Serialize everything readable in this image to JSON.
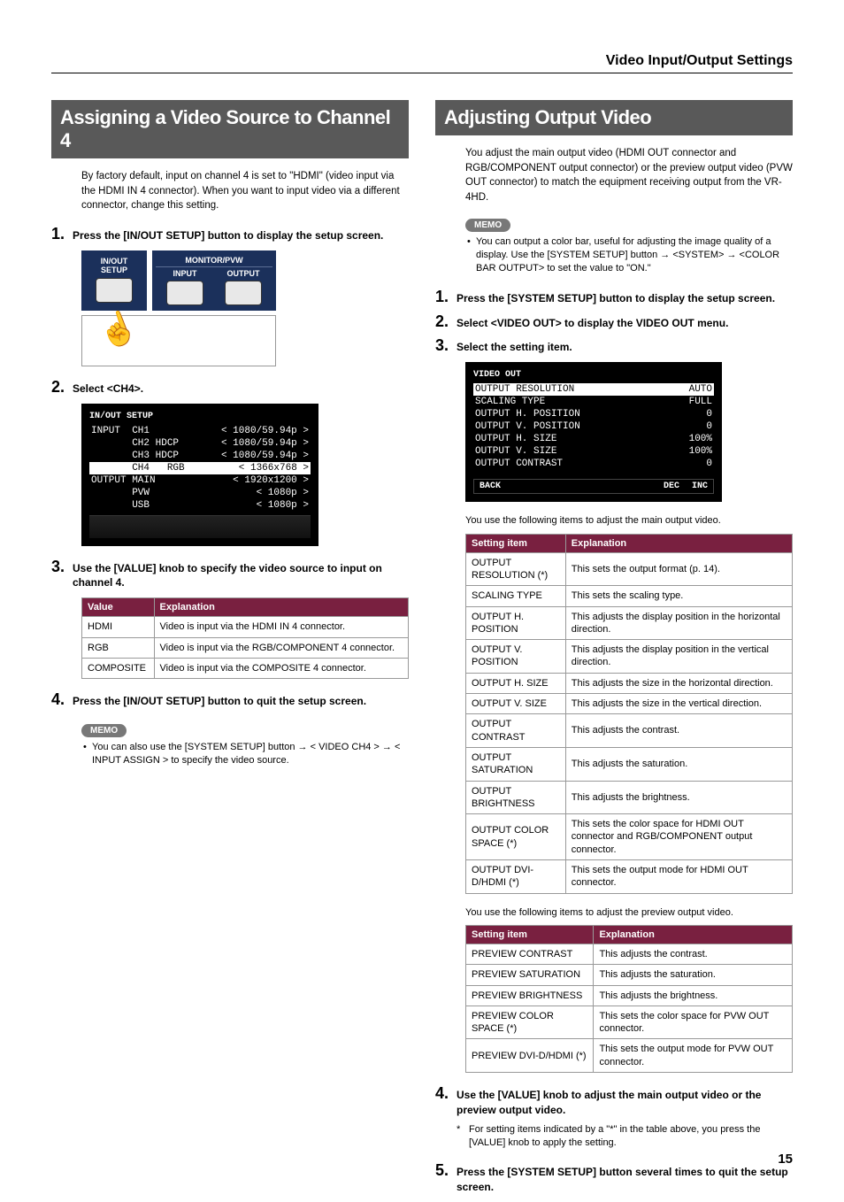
{
  "header": {
    "title": "Video Input/Output Settings"
  },
  "page_number": "15",
  "left": {
    "heading": "Assigning a Video Source to Channel 4",
    "intro": "By factory default, input on channel 4 is set to \"HDMI\" (video input via the HDMI IN 4 connector). When you want to input video via a different connector, change this setting.",
    "step1": "Press the [IN/OUT SETUP] button to display the setup screen.",
    "hw": {
      "inout": "IN/OUT\nSETUP",
      "monitorpvw": "MONITOR/PVW",
      "input": "INPUT",
      "output": "OUTPUT"
    },
    "step2": "Select <CH4>.",
    "lcd": {
      "title": "IN/OUT SETUP",
      "rows": [
        {
          "l": "INPUT  CH1",
          "r": "<  1080/59.94p >"
        },
        {
          "l": "       CH2 HDCP",
          "r": "<  1080/59.94p >"
        },
        {
          "l": "       CH3 HDCP",
          "r": "<  1080/59.94p >"
        },
        {
          "l": "       CH4",
          "mid": "RGB",
          "r": "<    1366x768 >",
          "sel": true
        },
        {
          "l": "OUTPUT MAIN",
          "r": "< 1920x1200 >"
        },
        {
          "l": "       PVW",
          "r": "< 1080p >"
        },
        {
          "l": "       USB",
          "r": "< 1080p >"
        }
      ]
    },
    "step3": "Use the [VALUE] knob to specify the video source to input on channel 4.",
    "table": {
      "headers": [
        "Value",
        "Explanation"
      ],
      "rows": [
        [
          "HDMI",
          "Video is input via the HDMI IN 4 connector."
        ],
        [
          "RGB",
          "Video is input via the RGB/COMPONENT 4 connector."
        ],
        [
          "COMPOSITE",
          "Video is input via the COMPOSITE 4 connector."
        ]
      ]
    },
    "step4": "Press the [IN/OUT SETUP] button to quit the setup screen.",
    "memo_label": "MEMO",
    "memo": "You can also use the [SYSTEM SETUP] button → < VIDEO CH4 > → < INPUT ASSIGN > to specify the video source."
  },
  "right": {
    "heading": "Adjusting Output Video",
    "intro": "You adjust the main output video (HDMI OUT connector and RGB/COMPONENT output connector) or the preview output video (PVW OUT connector) to match the equipment receiving output from the VR-4HD.",
    "memo_label": "MEMO",
    "memo": "You can output a color bar, useful for adjusting the image quality of a display. Use the [SYSTEM SETUP] button → <SYSTEM> → <COLOR BAR OUTPUT> to set the value to \"ON.\"",
    "step1": "Press the [SYSTEM SETUP] button to display the setup screen.",
    "step2": "Select <VIDEO OUT> to display the VIDEO OUT menu.",
    "step3": "Select the setting item.",
    "lcd": {
      "title": "VIDEO OUT",
      "rows": [
        {
          "l": "OUTPUT RESOLUTION",
          "r": "AUTO",
          "sel": true
        },
        {
          "l": "SCALING TYPE",
          "r": "FULL"
        },
        {
          "l": "OUTPUT H. POSITION",
          "r": "0"
        },
        {
          "l": "OUTPUT V. POSITION",
          "r": "0"
        },
        {
          "l": "OUTPUT H. SIZE",
          "r": "100%"
        },
        {
          "l": "OUTPUT V. SIZE",
          "r": "100%"
        },
        {
          "l": "OUTPUT CONTRAST",
          "r": "0"
        }
      ],
      "bottom": [
        "BACK",
        "DEC",
        "INC"
      ]
    },
    "table1_caption": "You use the following items to adjust the main output video.",
    "table1": {
      "headers": [
        "Setting item",
        "Explanation"
      ],
      "rows": [
        [
          "OUTPUT RESOLUTION (*)",
          "This sets the output format (p. 14)."
        ],
        [
          "SCALING TYPE",
          "This sets the scaling type."
        ],
        [
          "OUTPUT H. POSITION",
          "This adjusts the display position in the horizontal direction."
        ],
        [
          "OUTPUT V. POSITION",
          "This adjusts the display position in the vertical direction."
        ],
        [
          "OUTPUT H. SIZE",
          "This adjusts the size in the horizontal direction."
        ],
        [
          "OUTPUT V. SIZE",
          "This adjusts the size in the vertical direction."
        ],
        [
          "OUTPUT CONTRAST",
          "This adjusts the contrast."
        ],
        [
          "OUTPUT SATURATION",
          "This adjusts the saturation."
        ],
        [
          "OUTPUT BRIGHTNESS",
          "This adjusts the brightness."
        ],
        [
          "OUTPUT COLOR SPACE (*)",
          "This sets the color space for HDMI OUT connector and RGB/COMPONENT output connector."
        ],
        [
          "OUTPUT DVI-D/HDMI (*)",
          "This sets the output mode for HDMI OUT connector."
        ]
      ]
    },
    "table2_caption": "You use the following items to adjust the preview output video.",
    "table2": {
      "headers": [
        "Setting item",
        "Explanation"
      ],
      "rows": [
        [
          "PREVIEW CONTRAST",
          "This adjusts the contrast."
        ],
        [
          "PREVIEW SATURATION",
          "This adjusts the saturation."
        ],
        [
          "PREVIEW BRIGHTNESS",
          "This adjusts the brightness."
        ],
        [
          "PREVIEW COLOR SPACE (*)",
          "This sets the color space for PVW OUT connector."
        ],
        [
          "PREVIEW DVI-D/HDMI (*)",
          "This sets the output mode for PVW OUT connector."
        ]
      ]
    },
    "step4": "Use the [VALUE] knob to adjust the main output video or the preview output video.",
    "step4_note": "For setting items indicated by a \"*\" in the table above, you press the [VALUE] knob to apply the setting.",
    "step5": "Press the [SYSTEM SETUP] button several times to quit the setup screen."
  }
}
